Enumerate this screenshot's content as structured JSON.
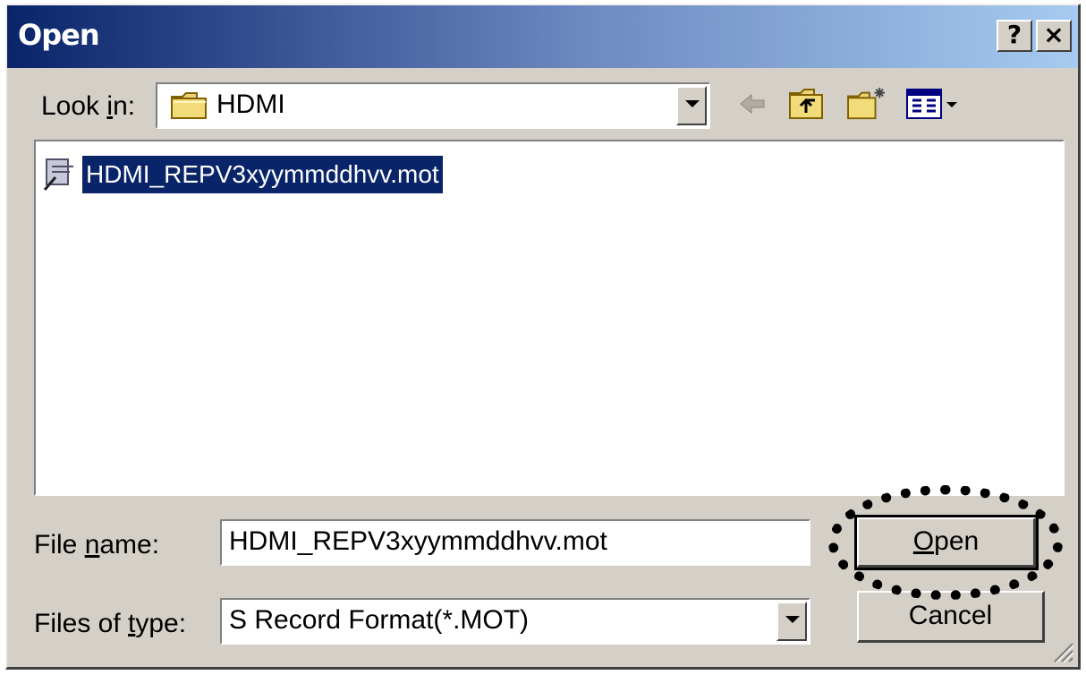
{
  "title_bar": {
    "title": "Open",
    "help_label": "?",
    "close_label": "×"
  },
  "look_in": {
    "label_pre": "Look ",
    "label_accel": "i",
    "label_post": "n:",
    "value": "HDMI",
    "icon": "folder-icon"
  },
  "toolbar": {
    "back_icon": "back-arrow-icon",
    "up_icon": "up-one-level-icon",
    "new_folder_icon": "new-folder-icon",
    "view_menu_icon": "view-menu-icon"
  },
  "file_list": {
    "items": [
      {
        "name": "HDMI_REPV3xyymmddhvv.mot",
        "icon": "file-icon",
        "selected": true
      }
    ]
  },
  "file_name": {
    "label_pre": "File ",
    "label_accel": "n",
    "label_post": "ame:",
    "value": "HDMI_REPV3xyymmddhvv.mot"
  },
  "file_type": {
    "label_pre": "Files of ",
    "label_accel": "t",
    "label_post": "ype:",
    "value": "S Record Format(*.MOT)"
  },
  "buttons": {
    "open_accel": "O",
    "open_rest": "pen",
    "cancel": "Cancel"
  },
  "colors": {
    "title_gradient_start": "#0a246a",
    "title_gradient_end": "#a6caf0",
    "selection": "#0a246a",
    "face": "#d4d0c8"
  }
}
